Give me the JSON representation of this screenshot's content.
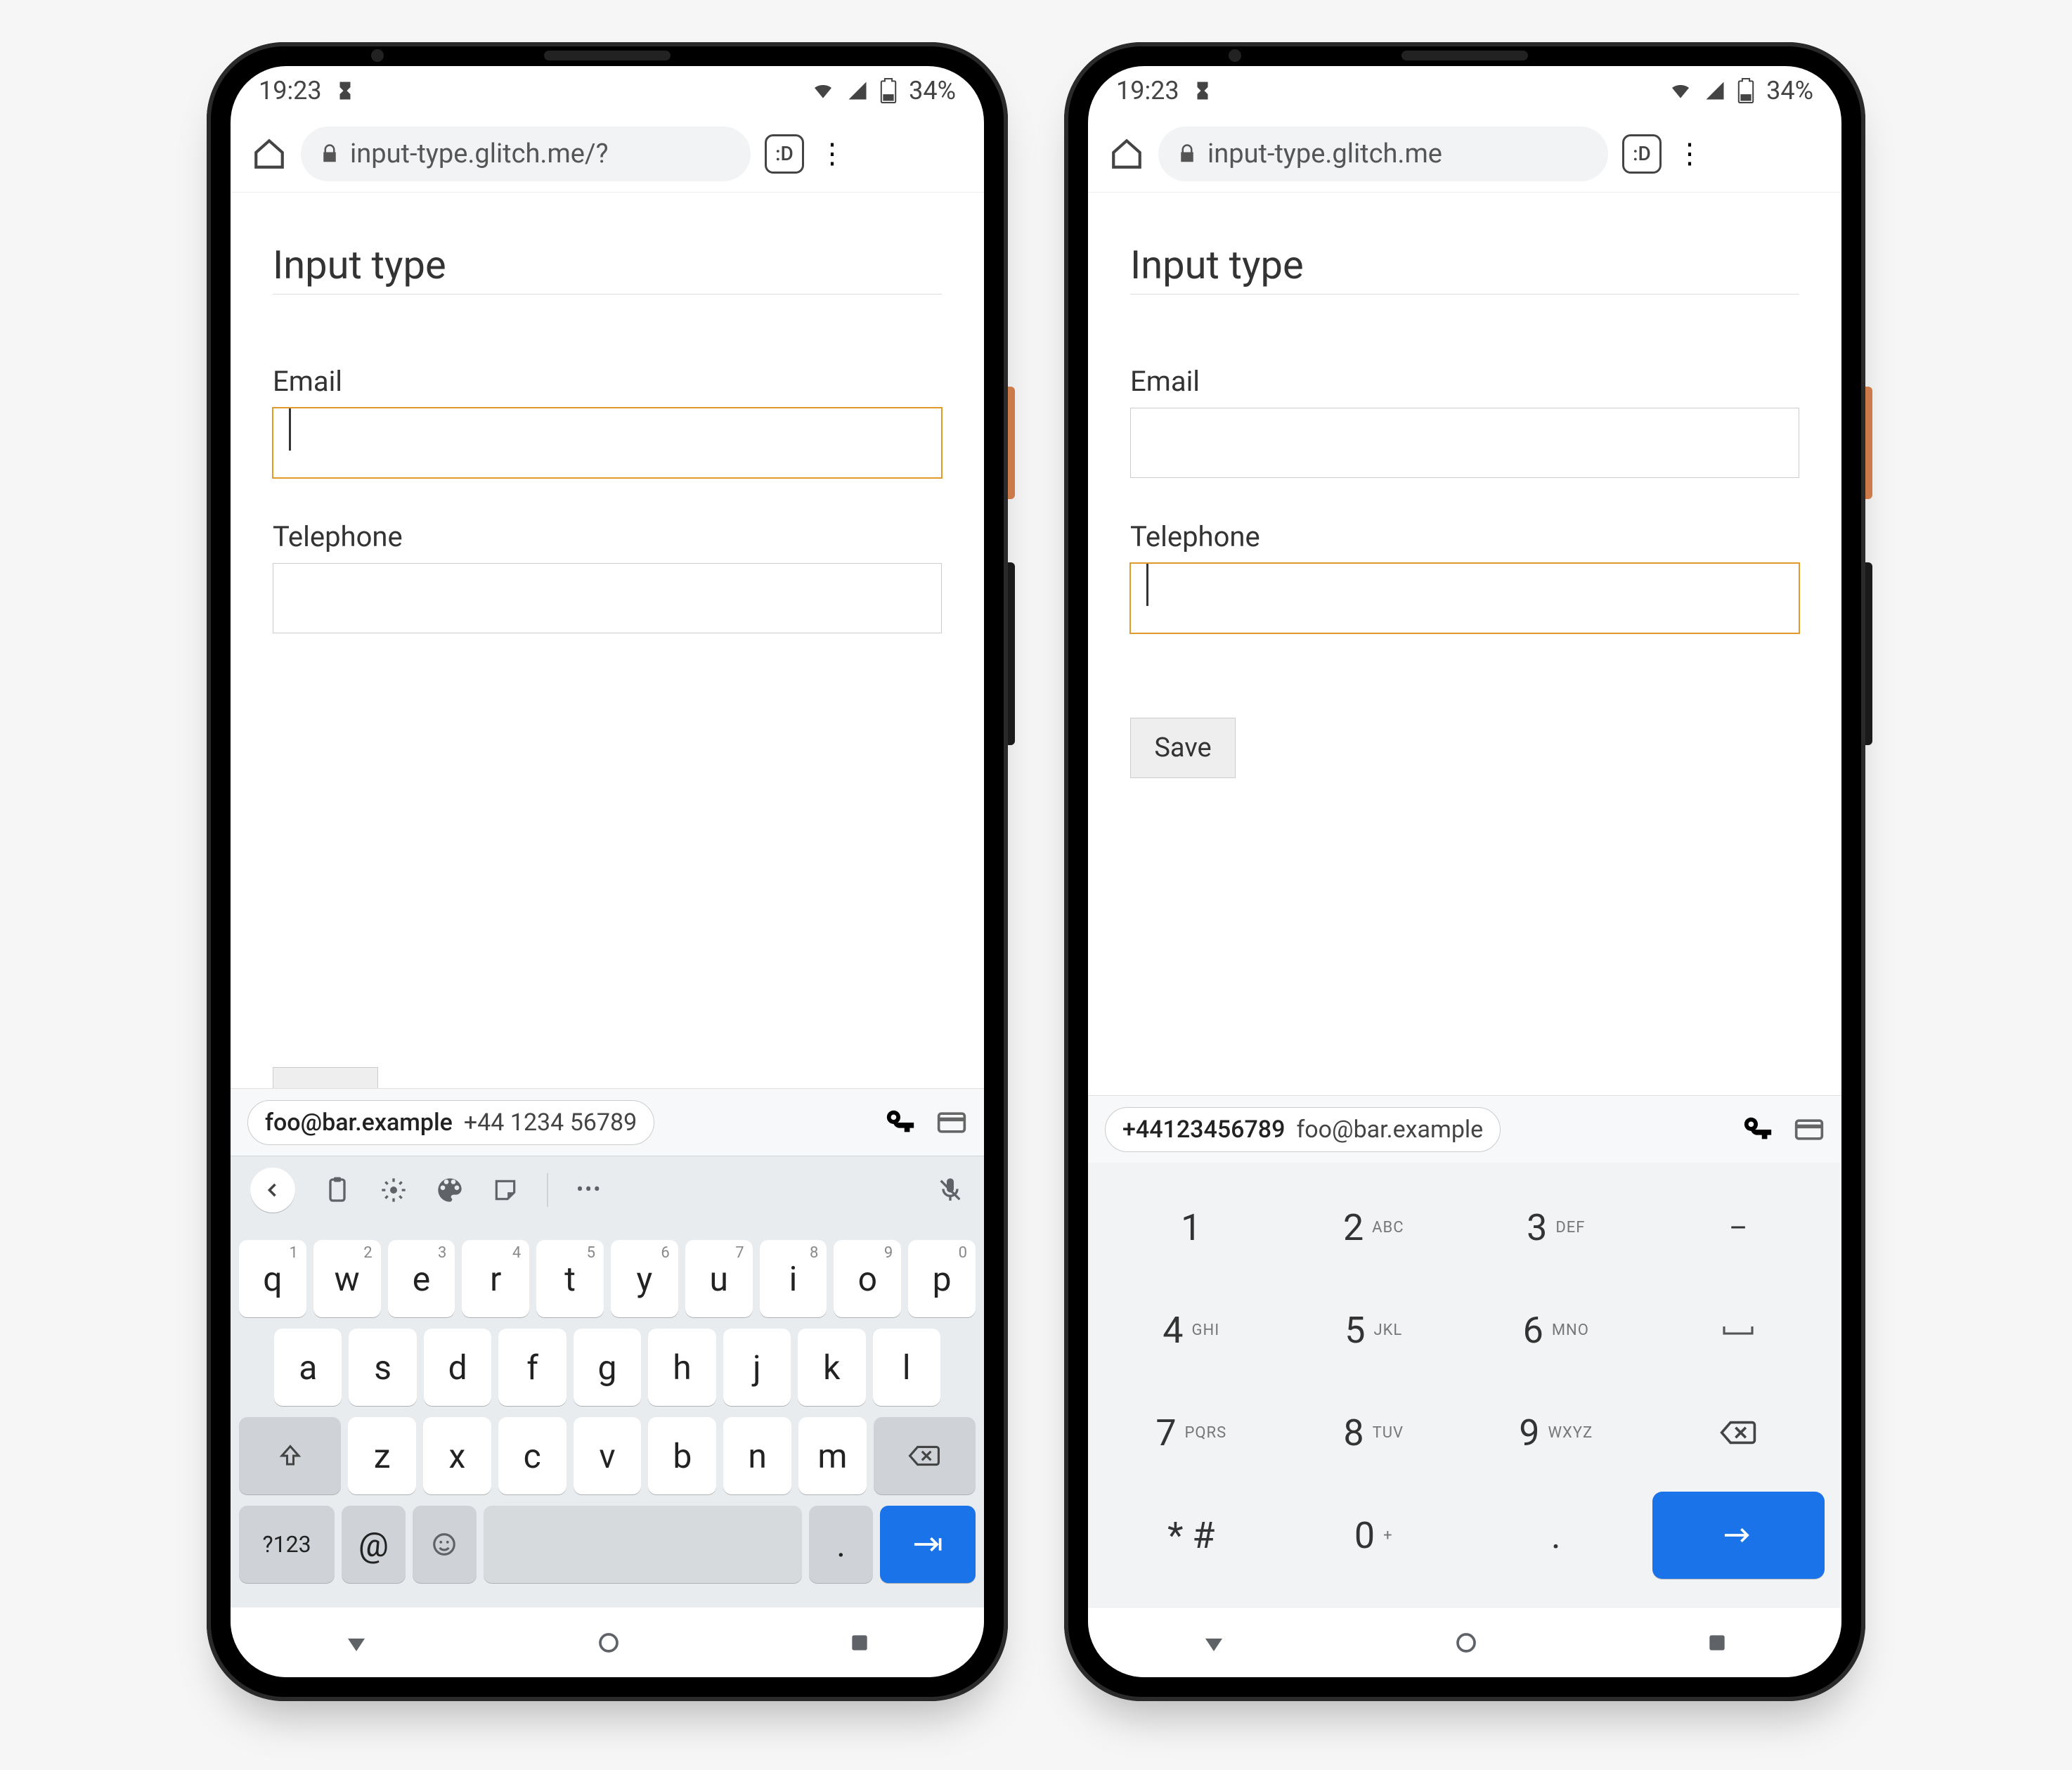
{
  "status": {
    "time": "19:23",
    "battery": "34%"
  },
  "browser": {
    "tab_count": ":D",
    "url_left": "input-type.glitch.me/?",
    "url_right": "input-type.glitch.me"
  },
  "page": {
    "heading": "Input type",
    "email_label": "Email",
    "tel_label": "Telephone",
    "save_label": "Save"
  },
  "autofill": {
    "email": "foo@bar.example",
    "phone_spaced": "+44 1234 56789",
    "phone_compact": "+44123456789"
  },
  "qwerty": {
    "row1": [
      {
        "k": "q",
        "s": "1"
      },
      {
        "k": "w",
        "s": "2"
      },
      {
        "k": "e",
        "s": "3"
      },
      {
        "k": "r",
        "s": "4"
      },
      {
        "k": "t",
        "s": "5"
      },
      {
        "k": "y",
        "s": "6"
      },
      {
        "k": "u",
        "s": "7"
      },
      {
        "k": "i",
        "s": "8"
      },
      {
        "k": "o",
        "s": "9"
      },
      {
        "k": "p",
        "s": "0"
      }
    ],
    "row2": [
      "a",
      "s",
      "d",
      "f",
      "g",
      "h",
      "j",
      "k",
      "l"
    ],
    "row3": [
      "z",
      "x",
      "c",
      "v",
      "b",
      "n",
      "m"
    ],
    "sym_key": "?123",
    "at_key": "@",
    "period_key": "."
  },
  "numpad": {
    "rows": [
      [
        {
          "n": "1",
          "s": ""
        },
        {
          "n": "2",
          "s": "ABC"
        },
        {
          "n": "3",
          "s": "DEF"
        }
      ],
      [
        {
          "n": "4",
          "s": "GHI"
        },
        {
          "n": "5",
          "s": "JKL"
        },
        {
          "n": "6",
          "s": "MNO"
        }
      ],
      [
        {
          "n": "7",
          "s": "PQRS"
        },
        {
          "n": "8",
          "s": "TUV"
        },
        {
          "n": "9",
          "s": "WXYZ"
        }
      ],
      [
        {
          "n": "* #",
          "s": ""
        },
        {
          "n": "0",
          "s": "+"
        },
        {
          "n": ".",
          "s": ""
        }
      ]
    ],
    "side": [
      "–",
      "⎵",
      "⌫",
      "→"
    ]
  }
}
